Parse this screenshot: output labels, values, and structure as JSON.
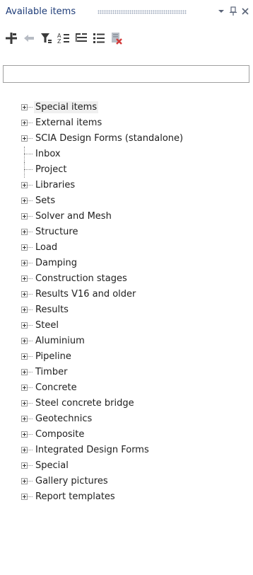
{
  "panel": {
    "title": "Available items",
    "dropdown_icon": "chevron-down-icon",
    "pin_icon": "pin-icon",
    "close_icon": "close-icon"
  },
  "toolbar": {
    "tools": [
      "add-icon",
      "back-arrow-icon",
      "filter-icon",
      "sort-alphabetical-icon",
      "tree-view-icon",
      "list-view-icon",
      "delete-icon"
    ]
  },
  "search": {
    "value": "",
    "placeholder": ""
  },
  "tree": {
    "items": [
      {
        "label": "Special items",
        "expandable": true
      },
      {
        "label": "External items",
        "expandable": true
      },
      {
        "label": "SCIA Design Forms (standalone)",
        "expandable": true
      },
      {
        "label": "Inbox",
        "expandable": false
      },
      {
        "label": "Project",
        "expandable": false
      },
      {
        "label": "Libraries",
        "expandable": true
      },
      {
        "label": "Sets",
        "expandable": true
      },
      {
        "label": "Solver and Mesh",
        "expandable": true
      },
      {
        "label": "Structure",
        "expandable": true
      },
      {
        "label": "Load",
        "expandable": true
      },
      {
        "label": "Damping",
        "expandable": true
      },
      {
        "label": "Construction stages",
        "expandable": true
      },
      {
        "label": "Results V16 and older",
        "expandable": true
      },
      {
        "label": "Results",
        "expandable": true
      },
      {
        "label": "Steel",
        "expandable": true
      },
      {
        "label": "Aluminium",
        "expandable": true
      },
      {
        "label": "Pipeline",
        "expandable": true
      },
      {
        "label": "Timber",
        "expandable": true
      },
      {
        "label": "Concrete",
        "expandable": true
      },
      {
        "label": "Steel concrete bridge",
        "expandable": true
      },
      {
        "label": "Geotechnics",
        "expandable": true
      },
      {
        "label": "Composite",
        "expandable": true
      },
      {
        "label": "Integrated Design Forms",
        "expandable": true
      },
      {
        "label": "Special",
        "expandable": true
      },
      {
        "label": "Gallery pictures",
        "expandable": true
      },
      {
        "label": "Report templates",
        "expandable": true
      }
    ]
  }
}
